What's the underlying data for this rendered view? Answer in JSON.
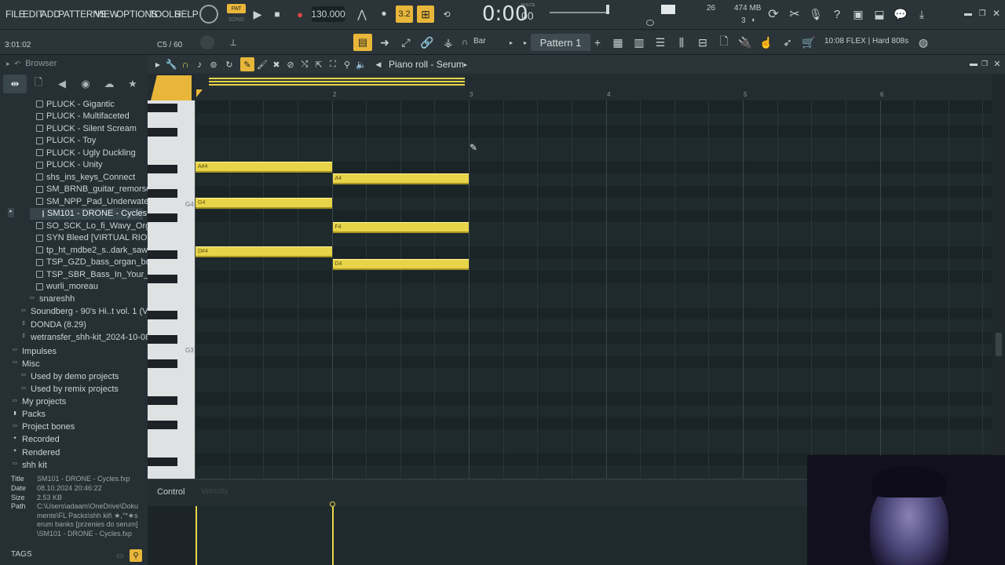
{
  "menu": [
    "FILE",
    "EDIT",
    "ADD",
    "PATTERNS",
    "VIEW",
    "OPTIONS",
    "TOOLS",
    "HELP"
  ],
  "transport": {
    "pat_label": "PAT",
    "song_label": "SONG",
    "tempo": "130.000",
    "time": "0:00",
    "time_small": "00",
    "time_unit": "M:S:CS",
    "mem": "474 MB",
    "cpu": "26",
    "poly": "3"
  },
  "hint": {
    "position": "3:01:02",
    "note_info": "C5 / 60"
  },
  "toolbar": {
    "snap": "Bar",
    "pattern": "Pattern 1",
    "news": "10:08 FLEX | Hard 808s"
  },
  "browser": {
    "title": "Browser",
    "items": [
      {
        "label": "PLUCK - Gigantic",
        "type": "file"
      },
      {
        "label": "PLUCK - Multifaceted",
        "type": "file"
      },
      {
        "label": "PLUCK - Silent Scream",
        "type": "file"
      },
      {
        "label": "PLUCK - Toy",
        "type": "file"
      },
      {
        "label": "PLUCK - Ugly Duckling",
        "type": "file"
      },
      {
        "label": "PLUCK - Unity",
        "type": "file"
      },
      {
        "label": "shs_ins_keys_Connect",
        "type": "file"
      },
      {
        "label": "SM_BRNB_guitar_remorse",
        "type": "file"
      },
      {
        "label": "SM_NPP_Pad_UnderwaterVibe",
        "type": "file"
      },
      {
        "label": "SM101 - DRONE - Cycles",
        "type": "file",
        "selected": true
      },
      {
        "label": "SO_SCK_Lo_fi_Wavy_Organ_Vinyl",
        "type": "file"
      },
      {
        "label": "SYN Bleed [VIRTUAL RIOT]",
        "type": "file"
      },
      {
        "label": "tp_ht_mdbe2_s..dark_saw_pluck",
        "type": "file"
      },
      {
        "label": "TSP_GZD_bass_organ_bounce",
        "type": "file"
      },
      {
        "label": "TSP_SBR_Bass_In_Your_Face",
        "type": "file"
      },
      {
        "label": "wurli_moreau",
        "type": "file"
      },
      {
        "label": "snareshh",
        "type": "folder",
        "indent": 2
      },
      {
        "label": "Soundberg - 90's Hi..t vol. 1 (Vintage)",
        "type": "folder",
        "indent": 1
      },
      {
        "label": "DONDA (8.29)",
        "type": "doc",
        "indent": 1
      },
      {
        "label": "wetransfer_shh-kit_2024-10-08_1813",
        "type": "doc",
        "indent": 1
      },
      {
        "label": "Impulses",
        "type": "folder",
        "indent": 0
      },
      {
        "label": "Misc",
        "type": "folder",
        "indent": 0
      },
      {
        "label": "Used by demo projects",
        "type": "folder",
        "indent": 1
      },
      {
        "label": "Used by remix projects",
        "type": "folder",
        "indent": 1
      },
      {
        "label": "My projects",
        "type": "folder",
        "indent": 0
      },
      {
        "label": "Packs",
        "type": "pack",
        "indent": 0
      },
      {
        "label": "Project bones",
        "type": "folder",
        "indent": 0
      },
      {
        "label": "Recorded",
        "type": "plus",
        "indent": 0
      },
      {
        "label": "Rendered",
        "type": "plus",
        "indent": 0
      },
      {
        "label": "shh kit",
        "type": "folder",
        "indent": 0
      }
    ],
    "info": {
      "title_k": "Title",
      "title": "SM101 - DRONE - Cycles.fxp",
      "date_k": "Date",
      "date": "08.10.2024 20:46:22",
      "size_k": "Size",
      "size": "2.53 KB",
      "path_k": "Path",
      "path": "C:\\Users\\adaam\\OneDrive\\Dokumente\\FL Packs\\shh kit\\ ★,°*★serum banks [przenies do serum]\\SM101 - DRONE - Cycles.fxp"
    },
    "tags": "TAGS"
  },
  "piano_roll": {
    "title": "Piano roll - Serum",
    "bar_numbers": [
      "2",
      "3",
      "4",
      "5",
      "6"
    ],
    "key_labels": {
      "g4": "G4",
      "g3": "G3"
    },
    "notes": [
      {
        "label": "A#4",
        "bar_start": 1,
        "bar_end": 2,
        "pitch": "A#4"
      },
      {
        "label": "A4",
        "bar_start": 2,
        "bar_end": 3,
        "pitch": "A4"
      },
      {
        "label": "G4",
        "bar_start": 1,
        "bar_end": 2,
        "pitch": "G4"
      },
      {
        "label": "F4",
        "bar_start": 2,
        "bar_end": 3,
        "pitch": "F4"
      },
      {
        "label": "D#4",
        "bar_start": 1,
        "bar_end": 2,
        "pitch": "D#4"
      },
      {
        "label": "D4",
        "bar_start": 2,
        "bar_end": 3,
        "pitch": "D4"
      }
    ]
  },
  "control": {
    "label": "Control",
    "sub": "Velocity"
  },
  "colors": {
    "accent": "#e8b63a",
    "note": "#e8d448",
    "bg": "#1e2a2c"
  }
}
